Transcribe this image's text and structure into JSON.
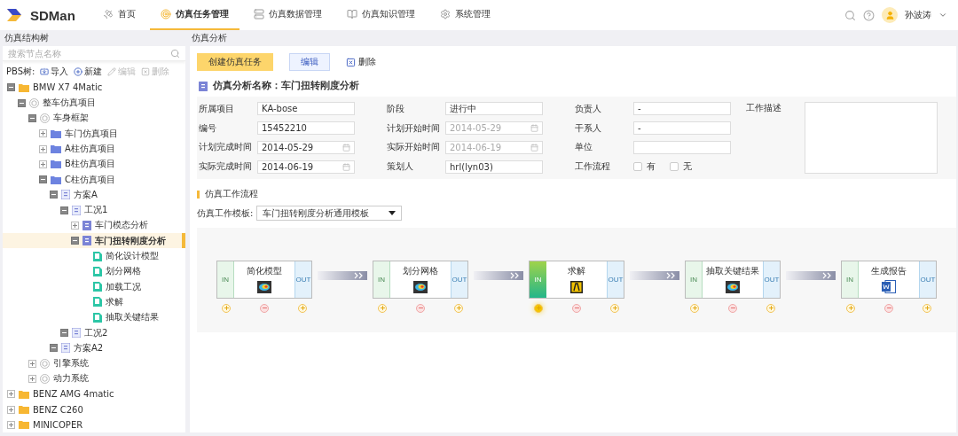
{
  "app": {
    "name": "SDMan"
  },
  "nav": [
    {
      "label": "首页",
      "selected": false
    },
    {
      "label": "仿真任务管理",
      "selected": true
    },
    {
      "label": "仿真数据管理",
      "selected": false
    },
    {
      "label": "仿真知识管理",
      "selected": false
    },
    {
      "label": "系统管理",
      "selected": false
    }
  ],
  "user": {
    "name": "孙波涛"
  },
  "left_panel": {
    "title": "仿真结构树",
    "search": {
      "placeholder": "搜索节点名称"
    },
    "toolbar_label": "PBS树:",
    "actions": [
      {
        "label": "导入",
        "disabled": false
      },
      {
        "label": "新建",
        "disabled": false
      },
      {
        "label": "编辑",
        "disabled": true
      },
      {
        "label": "删除",
        "disabled": true
      }
    ],
    "tree": [
      {
        "label": "BMW X7 4Matic",
        "kind": "folder",
        "expanded": true,
        "selected": false,
        "children": [
          {
            "label": "整车仿真项目",
            "kind": "cube",
            "expanded": true,
            "selected": false,
            "children": [
              {
                "label": "车身框架",
                "kind": "cube",
                "expanded": true,
                "selected": false,
                "children": [
                  {
                    "label": "车门仿真项目",
                    "kind": "project",
                    "expanded": false,
                    "selected": false
                  },
                  {
                    "label": "A柱仿真项目",
                    "kind": "project",
                    "expanded": false,
                    "selected": false
                  },
                  {
                    "label": "B柱仿真项目",
                    "kind": "project",
                    "expanded": false,
                    "selected": false
                  },
                  {
                    "label": "C柱仿真项目",
                    "kind": "project",
                    "expanded": true,
                    "selected": false,
                    "children": [
                      {
                        "label": "方案A",
                        "kind": "scheme",
                        "expanded": true,
                        "selected": false,
                        "children": [
                          {
                            "label": "工况1",
                            "kind": "case",
                            "expanded": true,
                            "selected": false,
                            "children": [
                              {
                                "label": "车门模态分析",
                                "kind": "analysis",
                                "expanded": false,
                                "selected": false
                              },
                              {
                                "label": "车门扭转刚度分析",
                                "kind": "analysis",
                                "expanded": true,
                                "selected": true,
                                "children": [
                                  {
                                    "label": "简化设计模型",
                                    "kind": "task",
                                    "selected": false
                                  },
                                  {
                                    "label": "划分网格",
                                    "kind": "task",
                                    "selected": false
                                  },
                                  {
                                    "label": "加载工况",
                                    "kind": "task",
                                    "selected": false
                                  },
                                  {
                                    "label": "求解",
                                    "kind": "task",
                                    "selected": false
                                  },
                                  {
                                    "label": "抽取关键结果",
                                    "kind": "task",
                                    "selected": false
                                  }
                                ]
                              }
                            ]
                          },
                          {
                            "label": "工况2",
                            "kind": "case",
                            "expanded": true,
                            "selected": false
                          }
                        ]
                      },
                      {
                        "label": "方案A2",
                        "kind": "scheme",
                        "expanded": true,
                        "selected": false
                      }
                    ]
                  }
                ]
              },
              {
                "label": "引擎系统",
                "kind": "cube",
                "expanded": false,
                "selected": false
              },
              {
                "label": "动力系统",
                "kind": "cube",
                "expanded": false,
                "selected": false
              }
            ]
          }
        ]
      },
      {
        "label": "BENZ AMG 4matic",
        "kind": "folder",
        "expanded": false,
        "selected": false
      },
      {
        "label": "BENZ C260",
        "kind": "folder",
        "expanded": false,
        "selected": false
      },
      {
        "label": "MINICOPER",
        "kind": "folder",
        "expanded": false,
        "selected": false
      }
    ]
  },
  "main": {
    "title": "仿真分析",
    "buttons": [
      {
        "label": "创建仿真任务",
        "kind": "primary"
      },
      {
        "label": "编辑",
        "kind": "secondary"
      },
      {
        "label": "删除",
        "kind": "delete"
      }
    ],
    "analysis_title": "仿真分析名称：车门扭转刚度分析",
    "fields": [
      {
        "label": "所属项目",
        "kind": "text",
        "value": "KA-bose"
      },
      {
        "label": "阶段",
        "kind": "text",
        "value": "进行中"
      },
      {
        "label": "负责人",
        "kind": "text",
        "value": "-"
      },
      {
        "label": "工作描述",
        "kind": "textarea"
      },
      {
        "label": "编号",
        "kind": "text",
        "value": "15452210"
      },
      {
        "label": "计划开始时间",
        "kind": "date",
        "value": "2014-05-29",
        "disabled": true
      },
      {
        "label": "干系人",
        "kind": "text",
        "value": "-"
      },
      {
        "label": "计划完成时间",
        "kind": "date",
        "value": "2014-05-29",
        "disabled": false
      },
      {
        "label": "实际开始时间",
        "kind": "date",
        "value": "2014-06-19",
        "disabled": true
      },
      {
        "label": "单位",
        "kind": "text"
      },
      {
        "label": "实际完成时间",
        "kind": "date",
        "value": "2014-06-19",
        "disabled": false
      },
      {
        "label": "策划人",
        "kind": "text",
        "value": "hrl(lyn03)"
      },
      {
        "label": "工作流程",
        "kind": "checkboxes",
        "options": [
          {
            "label": "有",
            "checked": false
          },
          {
            "label": "无",
            "checked": false
          }
        ]
      }
    ],
    "workflow": {
      "title": "仿真工作流程",
      "template_label": "仿真工作模板:",
      "template": "车门扭转刚度分析通用模板",
      "nodes": [
        {
          "title": "简化模型",
          "kind": "mesh",
          "in": "IN",
          "out": "OUT",
          "active": false
        },
        {
          "title": "划分网格",
          "kind": "mesh",
          "in": "IN",
          "out": "OUT",
          "active": false
        },
        {
          "title": "求解",
          "kind": "solver",
          "in": "IN",
          "out": "OUT",
          "active": true
        },
        {
          "title": "抽取关键结果",
          "kind": "mesh",
          "in": "IN",
          "out": "OUT",
          "active": false
        },
        {
          "title": "生成报告",
          "kind": "report",
          "in": "IN",
          "out": "OUT",
          "active": false
        }
      ]
    }
  }
}
